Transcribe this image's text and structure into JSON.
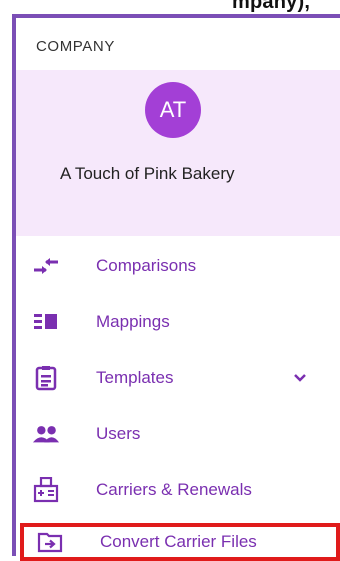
{
  "header_fragment": "mpany),",
  "sidebar": {
    "section_label": "COMPANY",
    "company": {
      "initials": "AT",
      "name": "A Touch of Pink Bakery"
    },
    "items": [
      {
        "label": "Comparisons",
        "icon": "compare-arrows-icon"
      },
      {
        "label": "Mappings",
        "icon": "mappings-icon"
      },
      {
        "label": "Templates",
        "icon": "clipboard-list-icon",
        "expandable": true
      },
      {
        "label": "Users",
        "icon": "users-icon"
      },
      {
        "label": "Carriers & Renewals",
        "icon": "carrier-calculator-icon"
      },
      {
        "label": "Convert Carrier Files",
        "icon": "folder-arrow-icon",
        "highlighted": true
      }
    ],
    "colors": {
      "accent": "#7a2fb0",
      "card_bg": "#f6e8fb",
      "avatar": "#a33fd6",
      "highlight_border": "#e01b1b"
    }
  }
}
